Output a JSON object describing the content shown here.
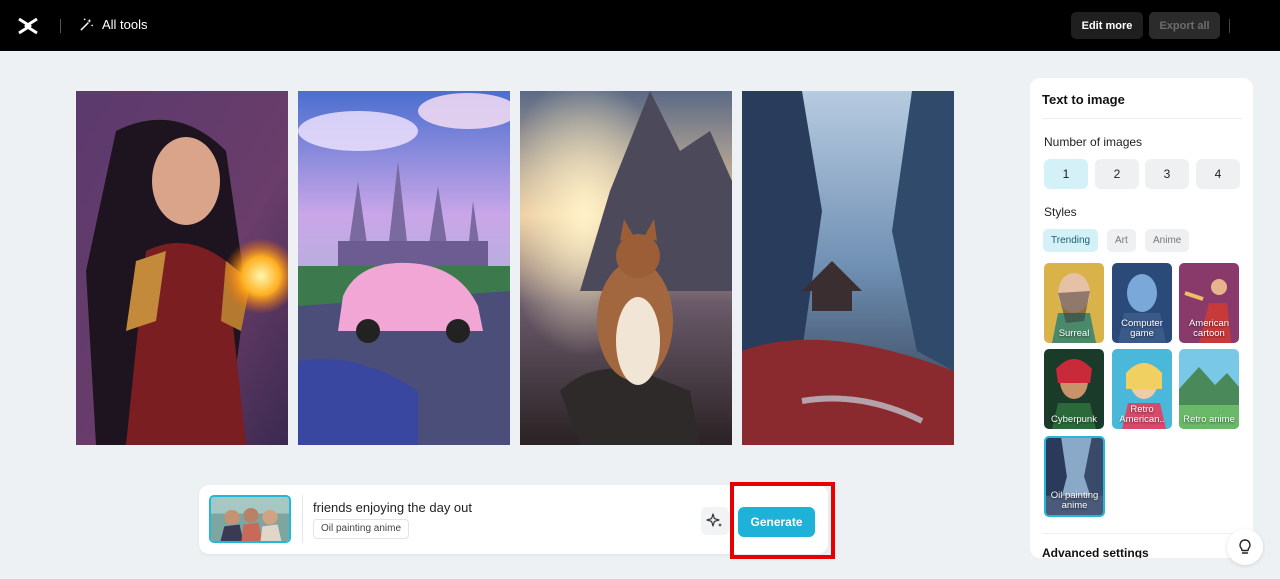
{
  "topbar": {
    "logo": "capcut-logo-icon",
    "all_tools_label": "All tools",
    "edit_more_label": "Edit more",
    "export_all_label": "Export all"
  },
  "gallery": {
    "images": [
      {
        "subject": "fantasy warrior woman with fireball"
      },
      {
        "subject": "pink car in front of castle"
      },
      {
        "subject": "cat sitting on rock at sunset"
      },
      {
        "subject": "misty mountain valley with pagoda"
      }
    ]
  },
  "prompt": {
    "text": "friends enjoying the day out",
    "style_tag": "Oil painting anime",
    "generate_label": "Generate"
  },
  "panel": {
    "title": "Text to image",
    "number_label": "Number of images",
    "numbers": [
      "1",
      "2",
      "3",
      "4"
    ],
    "selected_number": "1",
    "styles_label": "Styles",
    "style_tabs": [
      "Trending",
      "Art",
      "Anime"
    ],
    "selected_tab": "Trending",
    "styles": [
      {
        "label": "Surreal"
      },
      {
        "label": "Computer game"
      },
      {
        "label": "American cartoon"
      },
      {
        "label": "Cyberpunk"
      },
      {
        "label": "Retro American.."
      },
      {
        "label": "Retro anime"
      },
      {
        "label": "Oil painting anime"
      }
    ],
    "advanced_label": "Advanced settings"
  },
  "colors": {
    "accent": "#1fb2d8",
    "highlight_box": "#e60000"
  }
}
